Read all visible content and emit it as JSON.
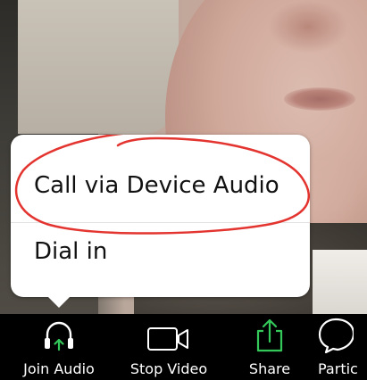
{
  "audio_popup": {
    "options": [
      {
        "label": "Call via Device Audio",
        "highlighted": true
      },
      {
        "label": "Dial in",
        "highlighted": false
      }
    ],
    "annotation_color": "#e3342f"
  },
  "toolbar": {
    "items": [
      {
        "label": "Join Audio",
        "icon": "headphones-icon"
      },
      {
        "label": "Stop Video",
        "icon": "video-camera-icon"
      },
      {
        "label": "Share",
        "icon": "share-icon"
      },
      {
        "label": "Partic",
        "icon": "participants-icon"
      }
    ]
  },
  "colors": {
    "accent_green": "#34c759",
    "toolbar_bg": "#000000",
    "popup_bg": "#ffffff"
  }
}
